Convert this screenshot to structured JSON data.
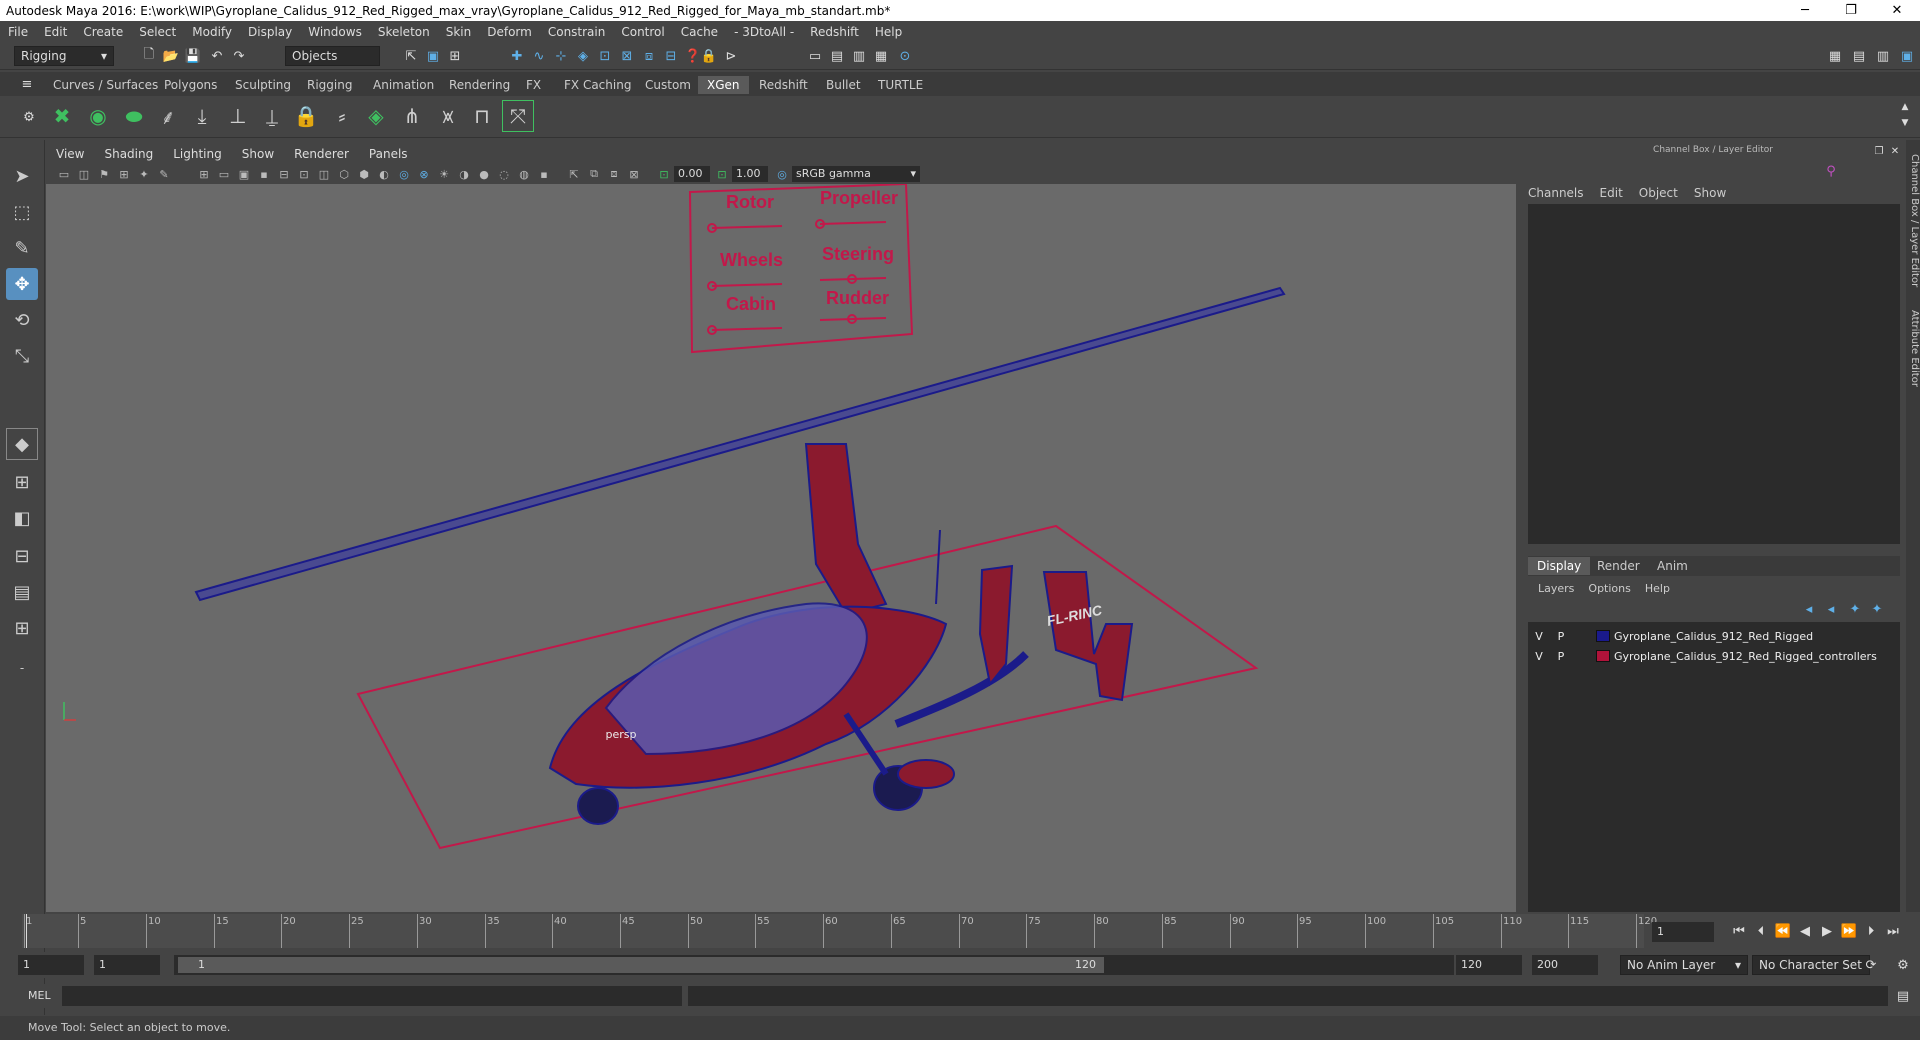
{
  "titlebar": {
    "title": "Autodesk Maya 2016: E:\\work\\WIP\\Gyroplane_Calidus_912_Red_Rigged_max_vray\\Gyroplane_Calidus_912_Red_Rigged_for_Maya_mb_standart.mb*",
    "minimize": "─",
    "restore": "❐",
    "close": "✕"
  },
  "menu": [
    "File",
    "Edit",
    "Create",
    "Select",
    "Modify",
    "Display",
    "Windows",
    "Skeleton",
    "Skin",
    "Deform",
    "Constrain",
    "Control",
    "Cache",
    "- 3DtoAll -",
    "Redshift",
    "Help"
  ],
  "status": {
    "mode": "Rigging",
    "selection_mode": "Objects"
  },
  "shelf_tabs": [
    "Curves / Surfaces",
    "Polygons",
    "Sculpting",
    "Rigging",
    "Animation",
    "Rendering",
    "FX",
    "FX Caching",
    "Custom",
    "XGen",
    "Redshift",
    "Bullet",
    "TURTLE"
  ],
  "active_shelf_tab": "XGen",
  "panel": {
    "menu": [
      "View",
      "Shading",
      "Lighting",
      "Show",
      "Renderer",
      "Panels"
    ],
    "exposure": "0.00",
    "gamma": "1.00",
    "color_space": "sRGB gamma",
    "camera": "persp"
  },
  "controller_board": {
    "rotor": "Rotor",
    "propeller": "Propeller",
    "wheels": "Wheels",
    "steering": "Steering",
    "cabin": "Cabin",
    "rudder": "Rudder"
  },
  "tail_text": "FL-RINC",
  "channel_box": {
    "title": "Channel Box / Layer Editor",
    "menu": [
      "Channels",
      "Edit",
      "Object",
      "Show"
    ]
  },
  "layer_editor": {
    "tabs": [
      "Display",
      "Render",
      "Anim"
    ],
    "active_tab": "Display",
    "menu": [
      "Layers",
      "Options",
      "Help"
    ],
    "layers": [
      {
        "v": "V",
        "p": "P",
        "name": "Gyroplane_Calidus_912_Red_Rigged",
        "color": "#1a1a8c"
      },
      {
        "v": "V",
        "p": "P",
        "name": "Gyroplane_Calidus_912_Red_Rigged_controllers",
        "color": "#b0133a"
      }
    ]
  },
  "side_tabs": [
    "Channel Box / Layer Editor",
    "Attribute Editor"
  ],
  "timeline": {
    "ticks": [
      "1",
      "5",
      "10",
      "15",
      "20",
      "25",
      "30",
      "35",
      "40",
      "45",
      "50",
      "55",
      "60",
      "65",
      "70",
      "75",
      "80",
      "85",
      "90",
      "95",
      "100",
      "105",
      "110",
      "115",
      "120"
    ],
    "current_frame": "1"
  },
  "range": {
    "start": "1",
    "playback_start": "1",
    "slider_start": "1",
    "slider_end": "120",
    "playback_end": "120",
    "end": "200",
    "anim_layer": "No Anim Layer",
    "character_set": "No Character Set"
  },
  "command_line": {
    "label": "MEL"
  },
  "help_line": "Move Tool: Select an object to move."
}
